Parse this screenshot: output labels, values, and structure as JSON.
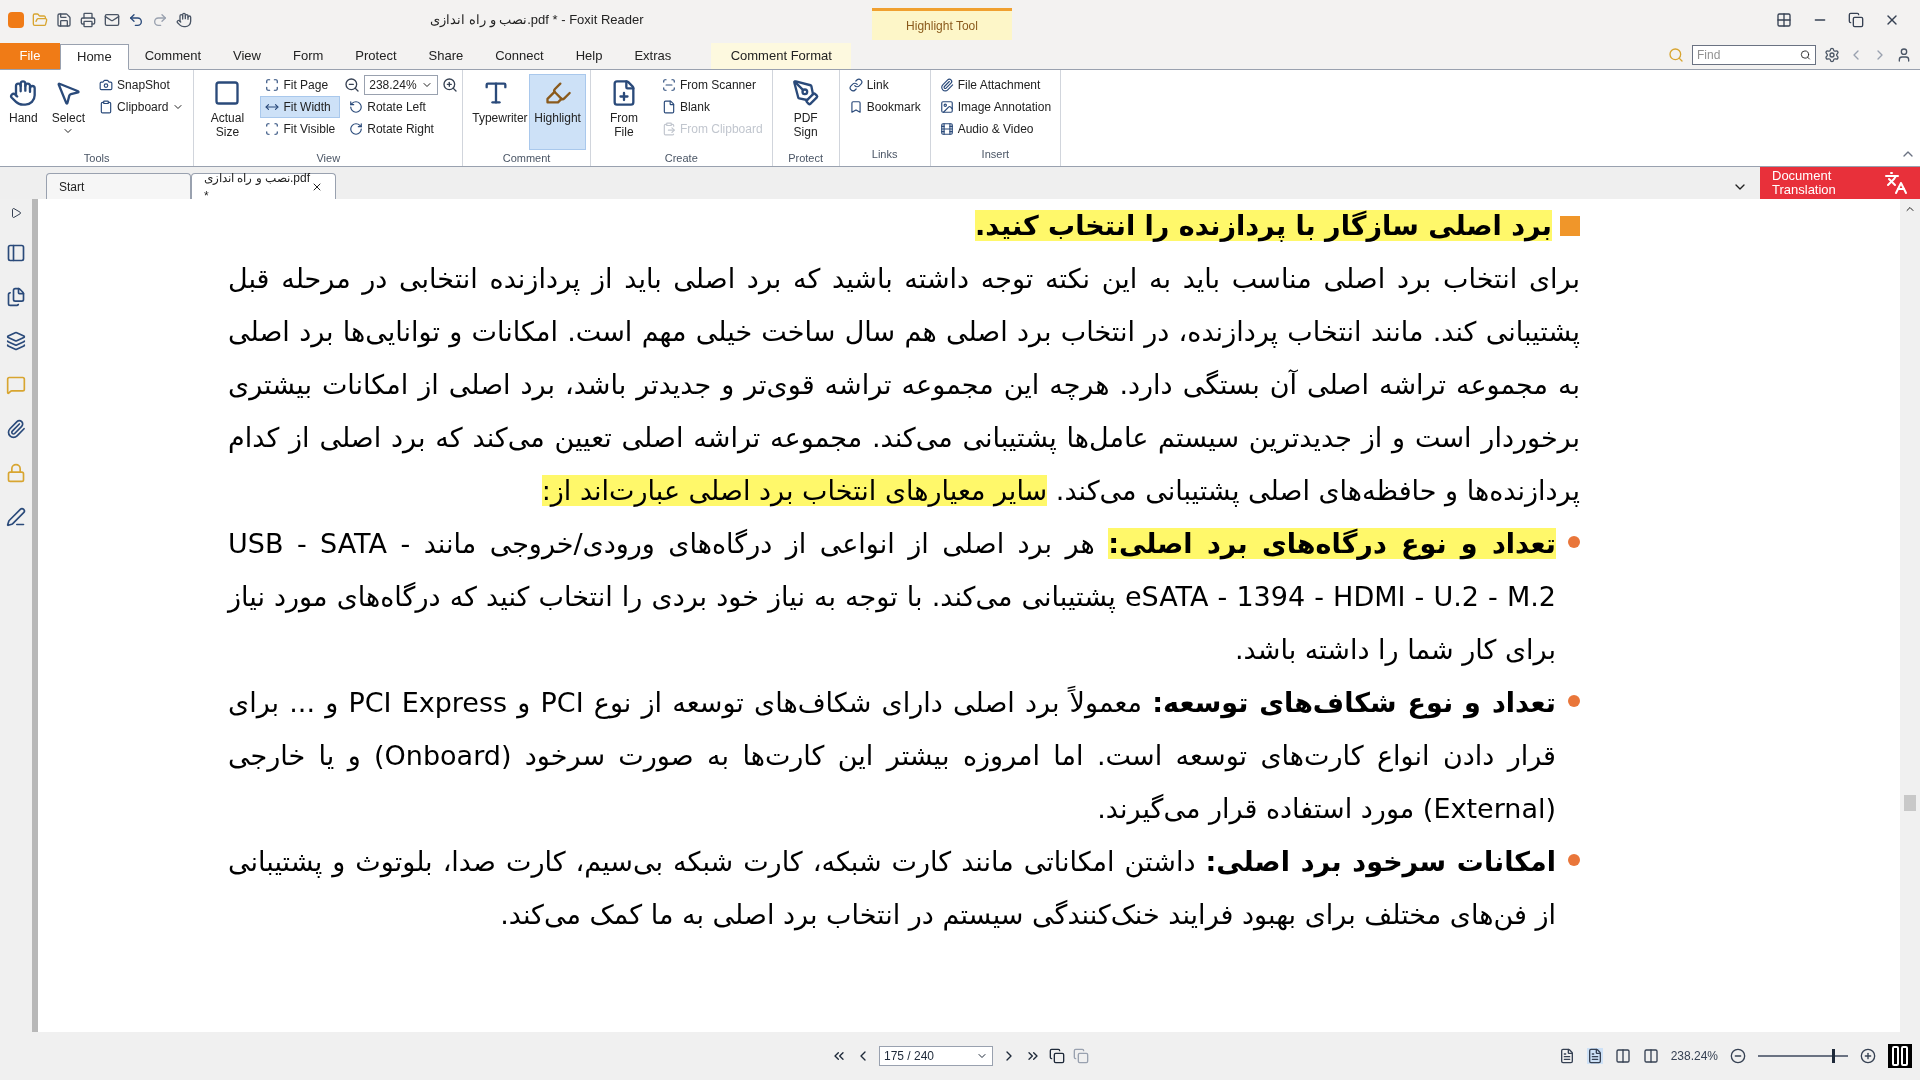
{
  "window": {
    "title": "نصب و راه اندازی.pdf * - Foxit Reader",
    "context_tab": "Highlight Tool"
  },
  "menu_tabs": [
    {
      "label": "File",
      "kind": "file",
      "selected": false
    },
    {
      "label": "Home",
      "kind": "tab",
      "selected": true
    },
    {
      "label": "Comment",
      "kind": "tab",
      "selected": false
    },
    {
      "label": "View",
      "kind": "tab",
      "selected": false
    },
    {
      "label": "Form",
      "kind": "tab",
      "selected": false
    },
    {
      "label": "Protect",
      "kind": "tab",
      "selected": false
    },
    {
      "label": "Share",
      "kind": "tab",
      "selected": false
    },
    {
      "label": "Connect",
      "kind": "tab",
      "selected": false
    },
    {
      "label": "Help",
      "kind": "tab",
      "selected": false
    },
    {
      "label": "Extras",
      "kind": "tab",
      "selected": false
    },
    {
      "label": "Comment Format",
      "kind": "context",
      "selected": false
    }
  ],
  "find": {
    "placeholder": "Find"
  },
  "ribbon": [
    {
      "label": "Tools",
      "columns": [
        {
          "kind": "large",
          "items": [
            {
              "label": "Hand",
              "kind": "button",
              "on": false,
              "disabled": false
            }
          ]
        },
        {
          "kind": "large",
          "items": [
            {
              "label": "Select",
              "kind": "menu",
              "on": false,
              "disabled": false
            }
          ]
        },
        {
          "kind": "stack",
          "items": [
            {
              "label": "SnapShot",
              "kind": "button",
              "on": false,
              "disabled": false
            },
            {
              "label": "Clipboard",
              "kind": "menu",
              "on": false,
              "disabled": false
            }
          ]
        }
      ]
    },
    {
      "label": "View",
      "columns": [
        {
          "kind": "large",
          "items": [
            {
              "label": "Actual Size",
              "kind": "button",
              "on": false,
              "disabled": false
            }
          ]
        },
        {
          "kind": "stack",
          "items": [
            {
              "label": "Fit Page",
              "kind": "button",
              "on": false,
              "disabled": false
            },
            {
              "label": "Fit Width",
              "kind": "button",
              "on": true,
              "disabled": false
            },
            {
              "label": "Fit Visible",
              "kind": "button",
              "on": false,
              "disabled": false
            }
          ]
        },
        {
          "kind": "stack",
          "items": [
            {
              "label": "238.24%",
              "kind": "zoom"
            },
            {
              "label": "Rotate Left",
              "kind": "button",
              "on": false,
              "disabled": false
            },
            {
              "label": "Rotate Right",
              "kind": "button",
              "on": false,
              "disabled": false
            }
          ]
        }
      ]
    },
    {
      "label": "Comment",
      "columns": [
        {
          "kind": "large",
          "items": [
            {
              "label": "Typewriter",
              "kind": "button",
              "on": false,
              "disabled": false
            }
          ]
        },
        {
          "kind": "large",
          "items": [
            {
              "label": "Highlight",
              "kind": "button",
              "on": true,
              "disabled": false
            }
          ]
        }
      ]
    },
    {
      "label": "Create",
      "columns": [
        {
          "kind": "large",
          "items": [
            {
              "label": "From File",
              "kind": "button",
              "on": false,
              "disabled": false
            }
          ]
        },
        {
          "kind": "stack",
          "items": [
            {
              "label": "From Scanner",
              "kind": "button",
              "on": false,
              "disabled": false
            },
            {
              "label": "Blank",
              "kind": "button",
              "on": false,
              "disabled": false
            },
            {
              "label": "From Clipboard",
              "kind": "button",
              "on": false,
              "disabled": true
            }
          ]
        }
      ]
    },
    {
      "label": "Protect",
      "columns": [
        {
          "kind": "large",
          "items": [
            {
              "label": "PDF Sign",
              "kind": "button",
              "on": false,
              "disabled": false
            }
          ]
        }
      ]
    },
    {
      "label": "Links",
      "columns": [
        {
          "kind": "stack",
          "items": [
            {
              "label": "Link",
              "kind": "button",
              "on": false,
              "disabled": false
            },
            {
              "label": "Bookmark",
              "kind": "button",
              "on": false,
              "disabled": false
            }
          ]
        }
      ]
    },
    {
      "label": "Insert",
      "columns": [
        {
          "kind": "stack",
          "items": [
            {
              "label": "File Attachment",
              "kind": "button",
              "on": false,
              "disabled": false
            },
            {
              "label": "Image Annotation",
              "kind": "button",
              "on": false,
              "disabled": false
            },
            {
              "label": "Audio & Video",
              "kind": "button",
              "on": false,
              "disabled": false
            }
          ]
        }
      ]
    }
  ],
  "doc_tabs": [
    {
      "label": "Start",
      "selected": false
    },
    {
      "label": "نصب و راه اندازی.pdf *",
      "selected": true
    }
  ],
  "translation_button": {
    "label": "Document Translation"
  },
  "document": {
    "paragraphs": [
      {
        "kind": "heading",
        "runs": [
          {
            "text": "برد اصلی سازگار با پردازنده را انتخاب کنید.",
            "bold": true,
            "highlighted": true
          }
        ]
      },
      {
        "kind": "text",
        "runs": [
          {
            "text": "برای انتخاب برد اصلی مناسب باید به این نکته توجه داشته باشید که برد اصلی باید از پردازنده انتخابی در مرحله قبل پشتیبانی کند. مانند انتخاب پردازنده، در انتخاب برد اصلی هم سال ساخت خیلی مهم است. امکانات و توانایی‌ها برد اصلی به مجموعه تراشه اصلی آن بستگی دارد. هرچه این مجموعه تراشه قوی‌تر و جدیدتر باشد، برد اصلی از امکانات بیشتری برخوردار است و از جدیدترین سیستم عامل‌ها پشتیبانی می‌کند. مجموعه تراشه اصلی تعیین می‌کند که برد اصلی از کدام پردازنده‌ها و حافظه‌های اصلی پشتیبانی می‌کند. ",
            "bold": false,
            "highlighted": false
          },
          {
            "text": "سایر معیارهای انتخاب برد اصلی عبارت‌اند از:",
            "bold": false,
            "highlighted": true
          }
        ]
      },
      {
        "kind": "bullet",
        "runs": [
          {
            "text": "تعداد و نوع درگاه‌های برد اصلی:",
            "bold": true,
            "highlighted": true
          },
          {
            "text": " هر برد اصلی از انواعی از درگاه‌های ورودی/خروجی مانند ",
            "bold": false,
            "highlighted": false
          },
          {
            "text": "USB - SATA - eSATA - 1394 - HDMI - U.2 - M.2",
            "bold": false,
            "highlighted": false
          },
          {
            "text": " پشتیبانی می‌کند. با توجه به نیاز خود بردی را انتخاب کنید که درگاه‌های مورد نیاز برای کار شما را داشته باشد.",
            "bold": false,
            "highlighted": false
          }
        ]
      },
      {
        "kind": "bullet",
        "runs": [
          {
            "text": "تعداد و نوع شکاف‌های توسعه:",
            "bold": true,
            "highlighted": false
          },
          {
            "text": " معمولاً برد اصلی دارای شکاف‌های توسعه از نوع PCI و PCI Express و ... برای قرار دادن انواع کارت‌های توسعه است. اما امروزه بیشتر این کارت‌ها به صورت سرخود (Onboard) و یا خارجی (External) مورد استفاده قرار می‌گیرند.",
            "bold": false,
            "highlighted": false
          }
        ]
      },
      {
        "kind": "bullet",
        "runs": [
          {
            "text": "امکانات سرخود برد اصلی:",
            "bold": true,
            "highlighted": false
          },
          {
            "text": " داشتن امکاناتی مانند کارت شبکه، کارت شبکه بی‌سیم، کارت صدا، بلوتوث و پشتیبانی از فن‌های مختلف برای بهبود فرایند خنک‌کنندگی سیستم در انتخاب برد اصلی به ما کمک می‌کند.",
            "bold": false,
            "highlighted": false
          }
        ]
      }
    ]
  },
  "status": {
    "page": "175 / 240",
    "zoom": "238.24%",
    "zoom_slider": {
      "level": 0.84
    }
  }
}
